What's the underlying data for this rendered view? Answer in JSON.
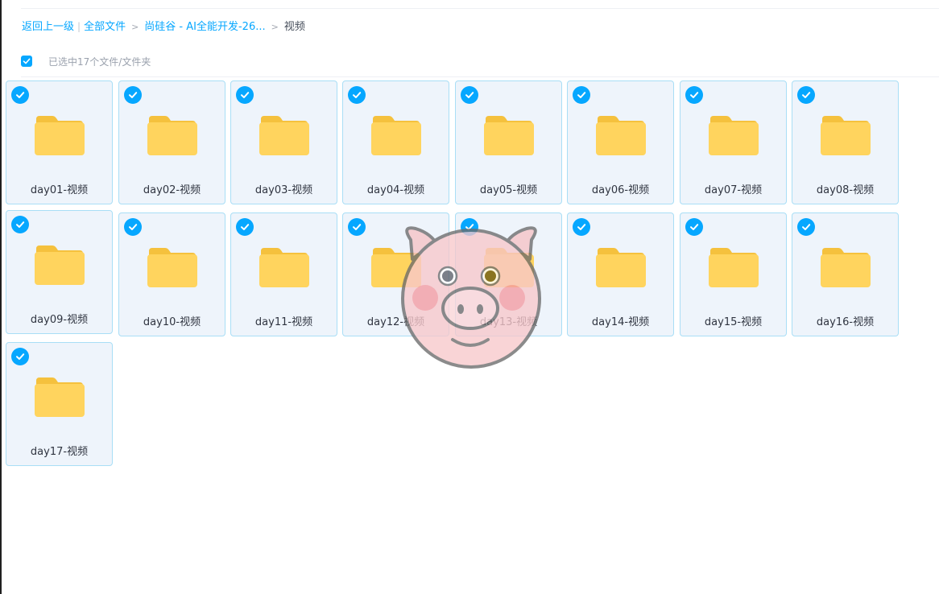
{
  "breadcrumb": {
    "back_label": "返回上一级",
    "all_files_label": "全部文件",
    "parent_label": "尚硅谷 - AI全能开发-26...",
    "current_label": "视频",
    "separator": ">",
    "pipe": "|"
  },
  "selection": {
    "status_text": "已选中17个文件/文件夹",
    "all_checked": true
  },
  "colors": {
    "accent": "#06a7ff",
    "folder": "#ffd45e",
    "folder_tab": "#f5c13d",
    "card_border": "#a9def6",
    "card_bg": "#eef4fb"
  },
  "icons": {
    "check": "check-icon",
    "folder": "folder-icon"
  },
  "files": [
    {
      "name": "day01-视频",
      "selected": true
    },
    {
      "name": "day02-视频",
      "selected": true
    },
    {
      "name": "day03-视频",
      "selected": true
    },
    {
      "name": "day04-视频",
      "selected": true
    },
    {
      "name": "day05-视频",
      "selected": true
    },
    {
      "name": "day06-视频",
      "selected": true
    },
    {
      "name": "day07-视频",
      "selected": true
    },
    {
      "name": "day08-视频",
      "selected": true
    },
    {
      "name": "day09-视频",
      "selected": true
    },
    {
      "name": "day10-视频",
      "selected": true
    },
    {
      "name": "day11-视频",
      "selected": true
    },
    {
      "name": "day12-视频",
      "selected": true
    },
    {
      "name": "day13-视频",
      "selected": true
    },
    {
      "name": "day14-视频",
      "selected": true
    },
    {
      "name": "day15-视频",
      "selected": true
    },
    {
      "name": "day16-视频",
      "selected": true
    },
    {
      "name": "day17-视频",
      "selected": true
    }
  ]
}
